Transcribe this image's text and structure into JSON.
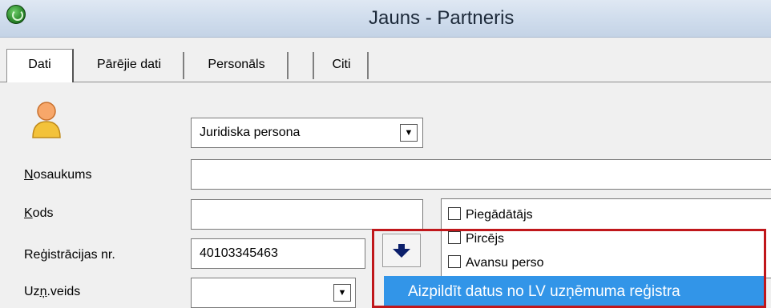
{
  "window": {
    "title": "Jauns - Partneris",
    "icon": "app-logo-icon"
  },
  "tabs": [
    {
      "label": "Dati",
      "active": true
    },
    {
      "label": "Pārējie dati",
      "active": false
    },
    {
      "label": "Personāls",
      "active": false
    },
    {
      "label": "",
      "active": false
    },
    {
      "label": "Citi",
      "active": false
    }
  ],
  "form": {
    "person_icon": "person-icon",
    "entity_type": {
      "value": "Juridiska persona",
      "icon": "chevron-down-icon"
    },
    "name": {
      "label_first": "N",
      "label_rest": "osaukums",
      "value": ""
    },
    "code": {
      "label_first": "K",
      "label_rest": "ods",
      "value": ""
    },
    "registration_no": {
      "label": "Reģistrācijas nr.",
      "value": "40103345463"
    },
    "company_type": {
      "label_a": "Uz",
      "label_u": "ņ",
      "label_b": ".veids",
      "value": ""
    }
  },
  "roles": [
    {
      "label": "Piegādātājs",
      "checked": false
    },
    {
      "label": "Pircējs",
      "checked": false
    },
    {
      "label": "Avansu perso",
      "checked": false
    }
  ],
  "dropdown_action": {
    "icon": "arrow-down-icon",
    "menu_item": "Aizpildīt datus no LV uzņēmuma reģistra"
  },
  "colors": {
    "menu_highlight": "#3295e8",
    "annotation_border": "#c0171b",
    "titlebar": "#cfdcec"
  }
}
